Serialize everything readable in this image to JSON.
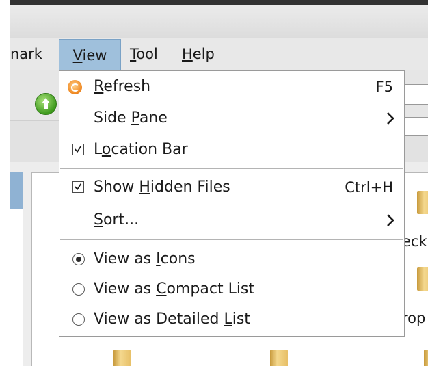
{
  "menubar": {
    "items": [
      {
        "label": "nark"
      },
      {
        "pre": "",
        "mnemonic": "V",
        "post": "iew"
      },
      {
        "pre": "",
        "mnemonic": "T",
        "post": "ool"
      },
      {
        "pre": "",
        "mnemonic": "H",
        "post": "elp"
      }
    ]
  },
  "view_menu": {
    "refresh": {
      "pre": "",
      "mnemonic": "R",
      "post": "efresh",
      "accel": "F5",
      "icon": "refresh-icon"
    },
    "side_pane": {
      "pre": "Side ",
      "mnemonic": "P",
      "post": "ane",
      "submenu": true
    },
    "location_bar": {
      "pre": "L",
      "mnemonic": "o",
      "post": "cation Bar",
      "checked": true
    },
    "show_hidden": {
      "pre": "Show ",
      "mnemonic": "H",
      "post": "idden Files",
      "accel": "Ctrl+H",
      "checked": true
    },
    "sort": {
      "pre": "",
      "mnemonic": "S",
      "post": "ort...",
      "submenu": true
    },
    "view_icons": {
      "pre": "View as ",
      "mnemonic": "I",
      "post": "cons",
      "selected": true
    },
    "view_compact": {
      "pre": "View as ",
      "mnemonic": "C",
      "post": "ompact List",
      "selected": false
    },
    "view_detailed": {
      "pre": "View as Detailed ",
      "mnemonic": "L",
      "post": "ist",
      "selected": false
    }
  },
  "files": {
    "label_1": "eck",
    "label_2": "rop"
  },
  "colors": {
    "menu_highlight": "#9fc0dc",
    "refresh_icon": "#f08a24",
    "up_icon": "#3f9a1e"
  }
}
